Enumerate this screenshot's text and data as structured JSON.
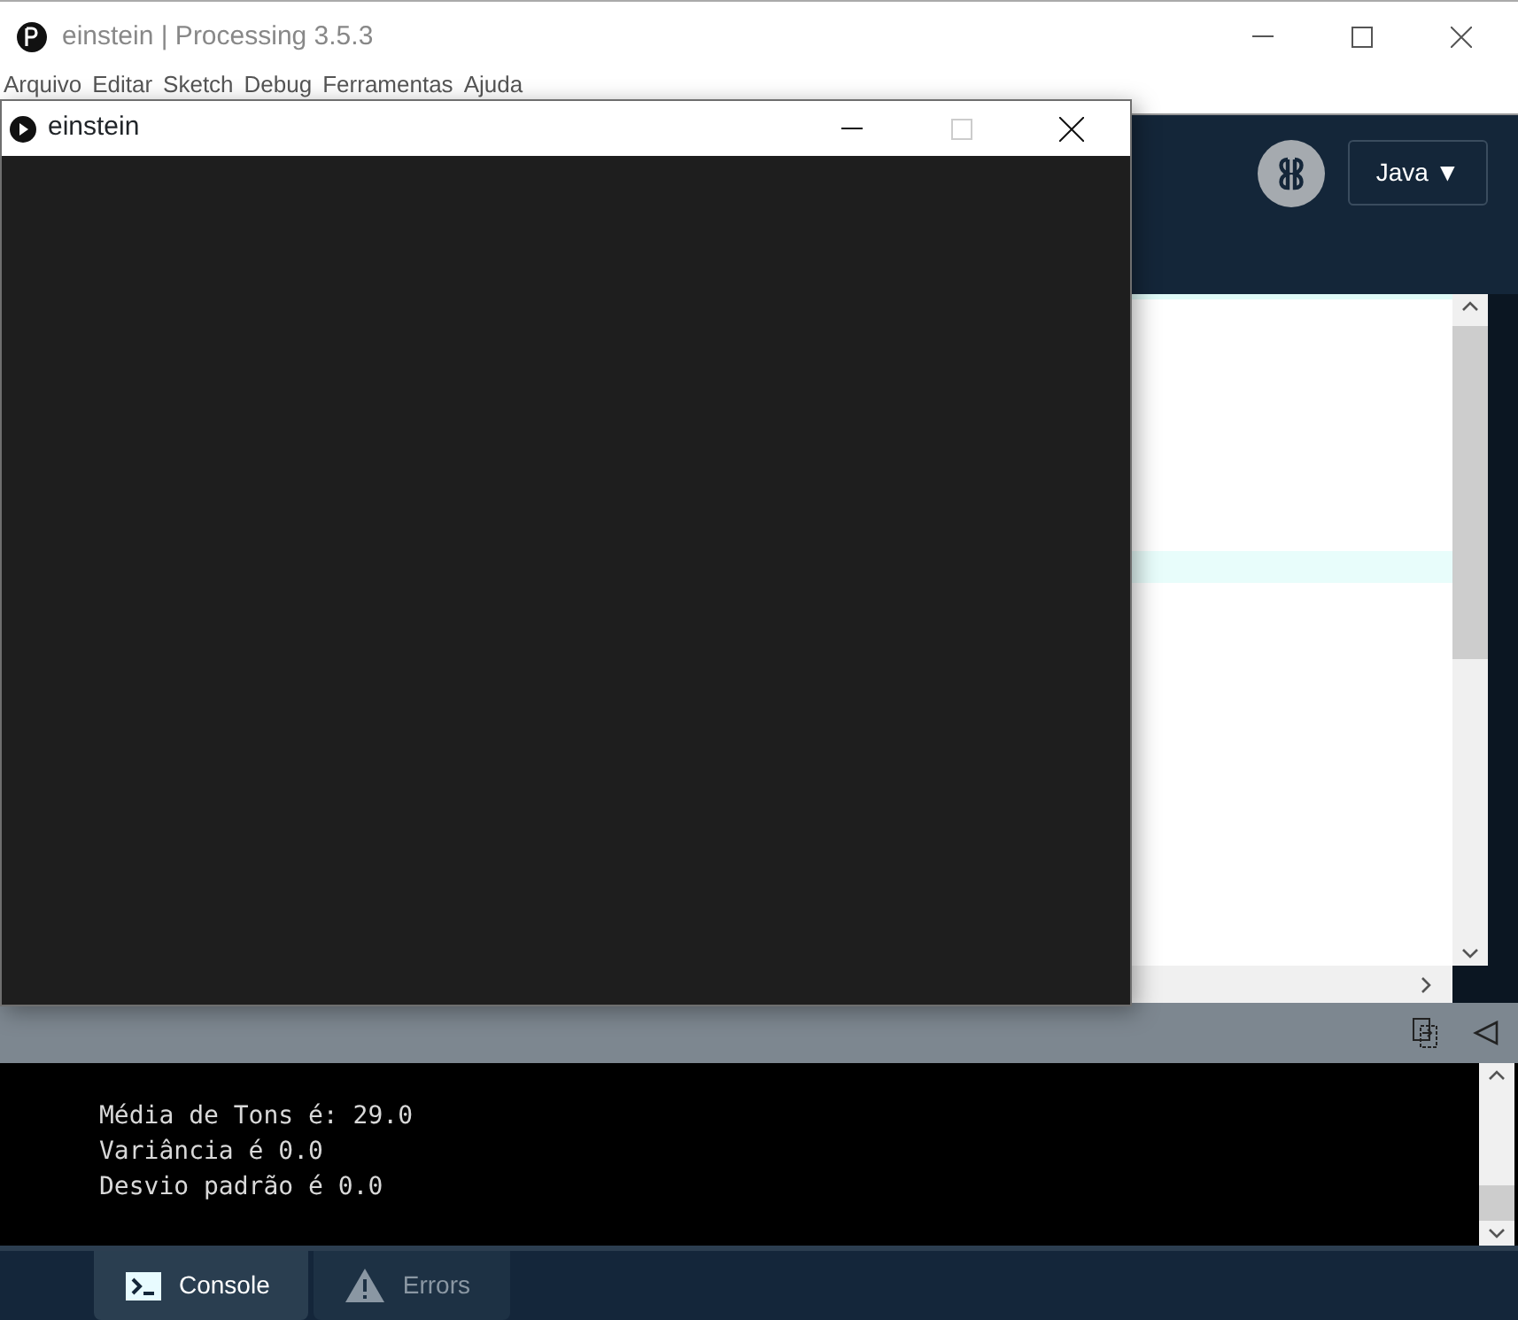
{
  "main_window": {
    "title": "einstein | Processing 3.5.3",
    "menu": [
      "Arquivo",
      "Editar",
      "Sketch",
      "Debug",
      "Ferramentas",
      "Ajuda"
    ],
    "mode_button": {
      "label": "Java",
      "arrow": "▼"
    },
    "console_lines": [
      "Média de Tons é: 29.0",
      "Variância é 0.0",
      "Desvio padrão é 0.0"
    ],
    "bottom_tabs": [
      {
        "label": "Console",
        "kind": "console",
        "selected": true
      },
      {
        "label": "Errors",
        "kind": "errors",
        "selected": false
      }
    ]
  },
  "sketch_window": {
    "title": "einstein"
  }
}
